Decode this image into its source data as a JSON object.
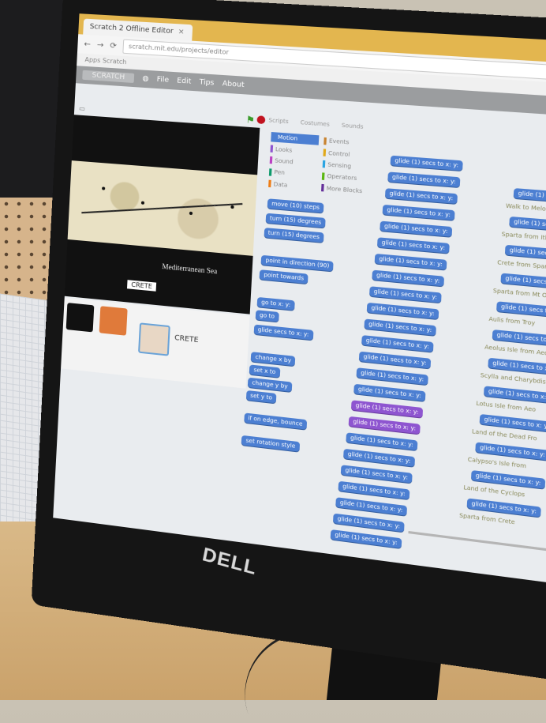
{
  "browser": {
    "tab_title": "Scratch 2 Offline Editor",
    "address": "scratch.mit.edu/projects/editor",
    "bookmarks": "Apps  Scratch"
  },
  "menu": {
    "logo": "SCRATCH",
    "items": [
      "File",
      "Edit",
      "Tips",
      "About"
    ]
  },
  "stage": {
    "map_label": "Mediterranean Sea",
    "sprite_label": "CRETE"
  },
  "sprites": {
    "selected_name": "CRETE"
  },
  "palette": {
    "tabs": [
      "Scripts",
      "Costumes",
      "Sounds"
    ],
    "categories": [
      {
        "label": "Motion",
        "color": "#4c7fd2",
        "selected": true
      },
      {
        "label": "Events",
        "color": "#c88330",
        "selected": false
      },
      {
        "label": "Looks",
        "color": "#8e55d0",
        "selected": false
      },
      {
        "label": "Control",
        "color": "#e1a91a",
        "selected": false
      },
      {
        "label": "Sound",
        "color": "#bb42c3",
        "selected": false
      },
      {
        "label": "Sensing",
        "color": "#2ca5e2",
        "selected": false
      },
      {
        "label": "Pen",
        "color": "#0e9a6c",
        "selected": false
      },
      {
        "label": "Operators",
        "color": "#5cb712",
        "selected": false
      },
      {
        "label": "Data",
        "color": "#ee7d16",
        "selected": false
      },
      {
        "label": "More Blocks",
        "color": "#632d99",
        "selected": false
      }
    ],
    "blocks": [
      "move (10) steps",
      "turn (15) degrees",
      "turn (15) degrees",
      "point in direction (90)",
      "point towards",
      "go to x: y:",
      "go to",
      "glide secs to x: y:",
      "change x by",
      "set x to",
      "change y by",
      "set y to",
      "if on edge, bounce",
      "set rotation style"
    ]
  },
  "script": {
    "glide_label": "glide (1) secs to x: y:",
    "say_items": [
      "Walk to Melos",
      "Sparta from Ithaca",
      "Crete from Sparta",
      "Sparta from Mt Olympus",
      "Aulis from Troy",
      "Aeolus Isle from Aeol",
      "Scylla and Charybdis",
      "Lotus Isle from Aeo",
      "Land of the Dead Fro",
      "Calypso's Isle from",
      "Land of the Cyclops",
      "Sparta from Crete"
    ]
  },
  "brand": "DELL"
}
